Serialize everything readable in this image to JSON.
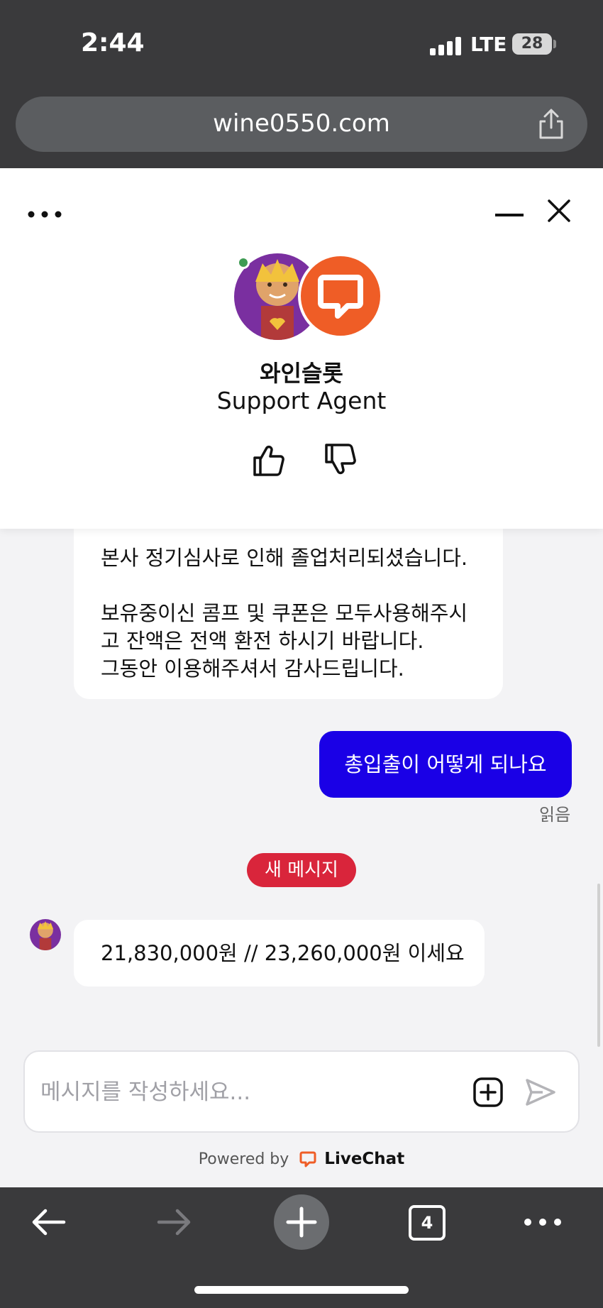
{
  "status_bar": {
    "time": "2:44",
    "network": "LTE",
    "battery": "28"
  },
  "browser": {
    "url": "wine0550.com",
    "tab_count": "4"
  },
  "chat_header": {
    "agent_name": "와인슬롯",
    "agent_role": "Support Agent"
  },
  "messages": {
    "agent_1_lines": [
      "본사 정기심사로 인해 졸업처리되셨습니다.",
      "보유중이신 콤프 및 쿠폰은 모두사용해주시",
      "고 잔액은 전액 환전 하시기 바랍니다.",
      "그동안 이용해주셔서 감사드립니다."
    ],
    "user_1": "총입출이 어떻게 되나요",
    "read_status": "읽음",
    "new_message_badge": "새 메시지",
    "agent_2": "21,830,000원 // 23,260,000원 이세요"
  },
  "composer": {
    "placeholder": "메시지를 작성하세요..."
  },
  "footer": {
    "powered_by": "Powered by",
    "brand": "LiveChat"
  },
  "colors": {
    "user_bubble": "#1a00e6",
    "badge": "#d9253b",
    "livechat_orange": "#ef5d26",
    "online": "#3e9b53"
  }
}
